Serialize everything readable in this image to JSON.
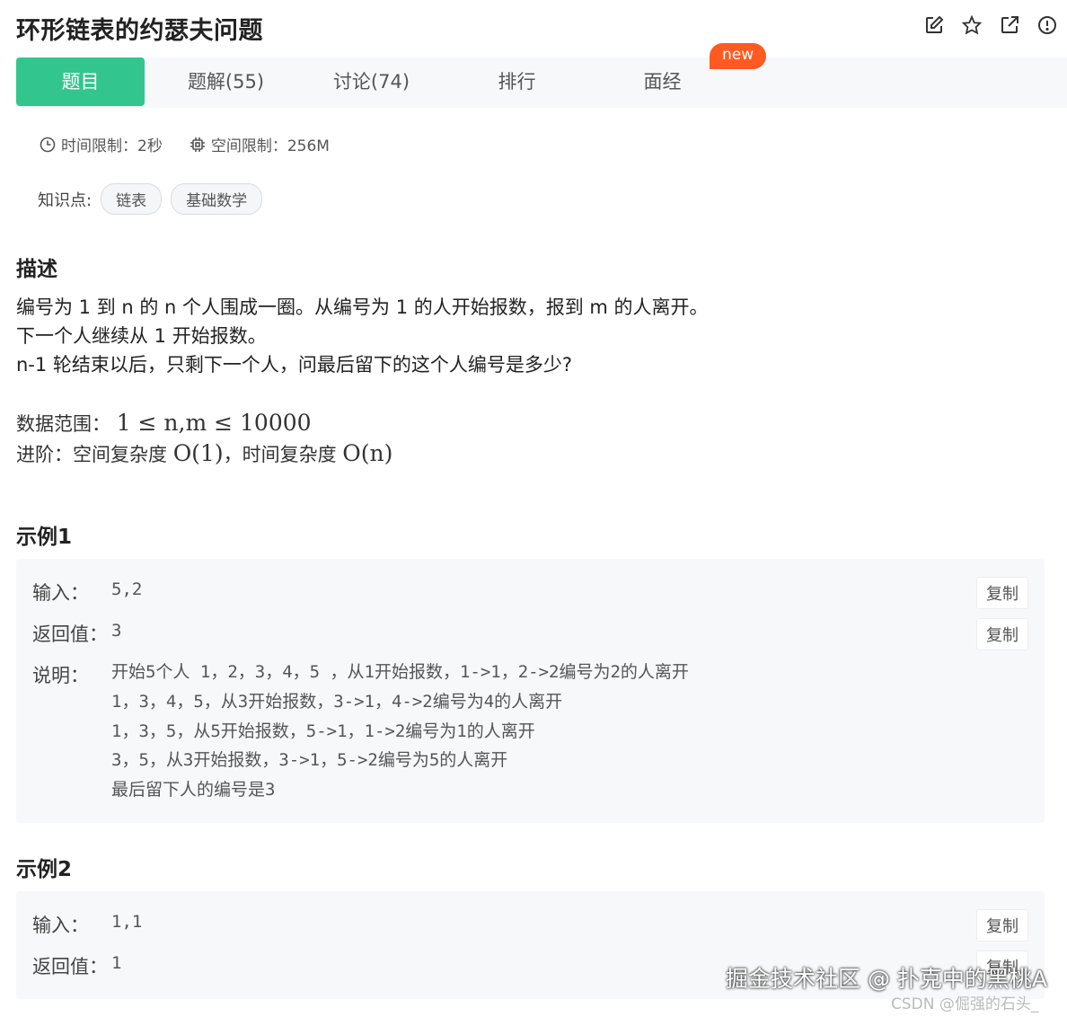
{
  "header": {
    "title": "环形链表的约瑟夫问题",
    "icons": [
      "edit-icon",
      "star-icon",
      "external-link-icon",
      "alert-icon"
    ]
  },
  "tabs": [
    {
      "label": "题目",
      "active": true
    },
    {
      "label": "题解(55)",
      "active": false
    },
    {
      "label": "讨论(74)",
      "active": false
    },
    {
      "label": "排行",
      "active": false
    },
    {
      "label": "面经",
      "active": false
    }
  ],
  "new_badge": "new",
  "limits": {
    "time": "时间限制：2秒",
    "space": "空间限制：256M"
  },
  "knowledge": {
    "label": "知识点:",
    "tags": [
      "链表",
      "基础数学"
    ]
  },
  "description": {
    "heading": "描述",
    "lines": [
      "编号为 1 到 n 的 n 个人围成一圈。从编号为 1 的人开始报数，报到 m 的人离开。",
      "下一个人继续从 1 开始报数。",
      "n-1 轮结束以后，只剩下一个人，问最后留下的这个人编号是多少?"
    ],
    "range_label": "数据范围：",
    "range_math": "1 ≤ n,m ≤ 10000",
    "advanced_label": "进阶：空间复杂度",
    "advanced_math1": "O(1)",
    "advanced_mid": "，时间复杂度",
    "advanced_math2": "O(n)"
  },
  "example1": {
    "heading": "示例1",
    "input_label": "输入：",
    "input_value": "5,2",
    "return_label": "返回值：",
    "return_value": "3",
    "explain_label": "说明：",
    "explain_lines": [
      "开始5个人 1，2，3，4，5 ，从1开始报数，1->1，2->2编号为2的人离开",
      "1，3，4，5，从3开始报数，3->1，4->2编号为4的人离开",
      "1，3，5，从5开始报数，5->1，1->2编号为1的人离开",
      "3，5，从3开始报数，3->1，5->2编号为5的人离开",
      "最后留下人的编号是3"
    ],
    "copy_label": "复制"
  },
  "example2": {
    "heading": "示例2",
    "input_label": "输入：",
    "input_value": "1,1",
    "return_label": "返回值：",
    "return_value": "1",
    "copy_label": "复制"
  },
  "watermark": {
    "main": "掘金技术社区 @ 扑克中的黑桃A",
    "sub": "CSDN @倔强的石头_"
  }
}
